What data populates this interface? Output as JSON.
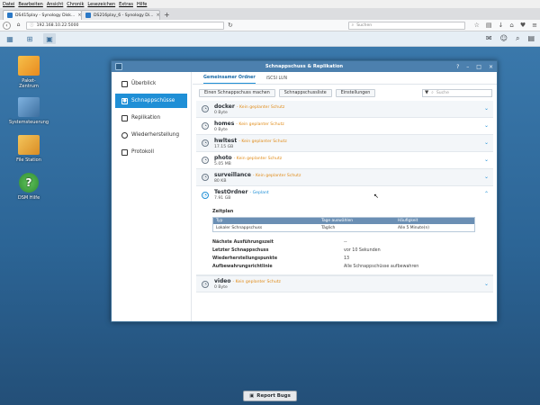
{
  "browser": {
    "menu": [
      "Datei",
      "Bearbeiten",
      "Ansicht",
      "Chronik",
      "Lesezeichen",
      "Extras",
      "Hilfe"
    ],
    "tabs": [
      {
        "label": "DS415play - Synology Disk...",
        "active": true
      },
      {
        "label": "DS216play_6 - Synology Di...",
        "active": false
      }
    ],
    "url": "192.168.10.22:5000",
    "search_placeholder": "Suchen"
  },
  "desktop": {
    "icons": [
      {
        "label": "Paket-\nZentrum",
        "color": "#f2a72c"
      },
      {
        "label": "Systemsteuerung",
        "color": "#5c8fc2"
      },
      {
        "label": "File Station",
        "color": "#e8a53a"
      },
      {
        "label": "DSM Hilfe",
        "color": "#49a84a"
      }
    ]
  },
  "window": {
    "title": "Schnappschuss & Replikation",
    "sidebar": [
      {
        "label": "Überblick",
        "active": false
      },
      {
        "label": "Schnappschüsse",
        "active": true
      },
      {
        "label": "Replikation",
        "active": false
      },
      {
        "label": "Wiederherstellung",
        "active": false
      },
      {
        "label": "Protokoll",
        "active": false
      }
    ],
    "tabs": [
      "Gemeinsamer Ordner",
      "iSCSI LUN"
    ],
    "toolbar": {
      "take": "Einen Schnappschuss machen",
      "list": "Schnappschussliste",
      "settings": "Einstellungen",
      "search_placeholder": "Suche"
    },
    "rows": [
      {
        "name": "docker",
        "status": "- Kein geplanter Schutz",
        "size": "0 Byte"
      },
      {
        "name": "homes",
        "status": "- Kein geplanter Schutz",
        "size": "0 Byte"
      },
      {
        "name": "hwltest",
        "status": "- Kein geplanter Schutz",
        "size": "17.15 GB"
      },
      {
        "name": "photo",
        "status": "- Kein geplanter Schutz",
        "size": "5.05 MB"
      },
      {
        "name": "surveillance",
        "status": "- Kein geplanter Schutz",
        "size": "80 KB"
      }
    ],
    "expanded": {
      "name": "TestOrdner",
      "status": "- Geplant",
      "size": "7.91 GB",
      "schedule_label": "Zeitplan",
      "schedule_headers": [
        "Typ",
        "Tage auswählen",
        "Häufigkeit"
      ],
      "schedule_row": [
        "Lokaler Schnappschuss",
        "Täglich",
        "Alle 5 Minute(n)"
      ],
      "details": [
        {
          "k": "Nächste Ausführungszeit",
          "v": "--"
        },
        {
          "k": "Letzter Schnappschuss",
          "v": "vor 10 Sekunden"
        },
        {
          "k": "Wiederherstellungspunkte",
          "v": "13"
        },
        {
          "k": "Aufbewahrungsrichtlinie",
          "v": "Alle Schnappschüsse aufbewahren"
        }
      ]
    },
    "last_row": {
      "name": "video",
      "status": "- Kein geplanter Schutz",
      "size": "0 Byte"
    }
  },
  "report_button": "Report Bugs",
  "colors": {
    "accent": "#1f8fd6",
    "warning": "#e08b18",
    "titlebar": "#4c80ae"
  }
}
